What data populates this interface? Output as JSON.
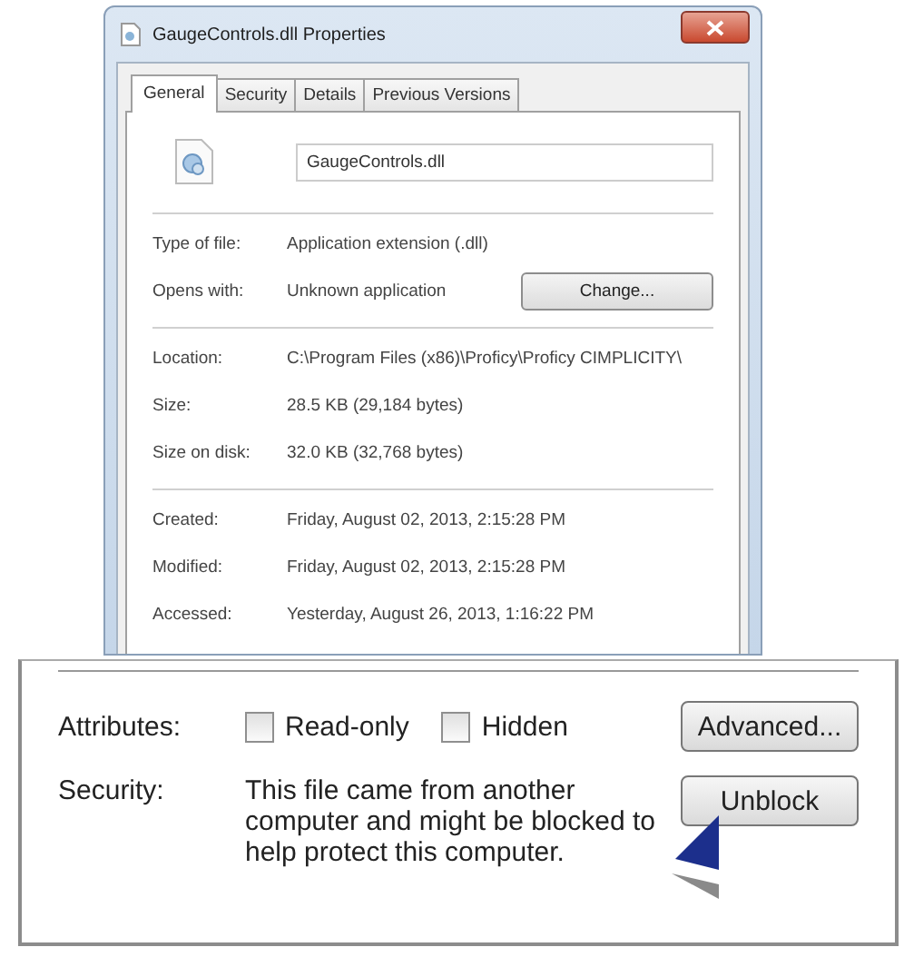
{
  "window": {
    "title": "GaugeControls.dll Properties"
  },
  "tabs": [
    {
      "label": "General",
      "selected": true
    },
    {
      "label": "Security",
      "selected": false
    },
    {
      "label": "Details",
      "selected": false
    },
    {
      "label": "Previous Versions",
      "selected": false
    }
  ],
  "file_name": "GaugeControls.dll",
  "sections": [
    [
      {
        "label": "Type of file:",
        "value": "Application extension (.dll)"
      },
      {
        "label": "Opens with:",
        "value": "Unknown application",
        "button": "Change..."
      }
    ],
    [
      {
        "label": "Location:",
        "value": "C:\\Program Files (x86)\\Proficy\\Proficy CIMPLICITY\\"
      },
      {
        "label": "Size:",
        "value": "28.5 KB (29,184 bytes)"
      },
      {
        "label": "Size on disk:",
        "value": "32.0 KB (32,768 bytes)"
      }
    ],
    [
      {
        "label": "Created:",
        "value": "Friday, August 02, 2013, 2:15:28 PM"
      },
      {
        "label": "Modified:",
        "value": "Friday, August 02, 2013, 2:15:28 PM"
      },
      {
        "label": "Accessed:",
        "value": "Yesterday, August 26, 2013, 1:16:22 PM"
      }
    ]
  ],
  "zoom_panel": {
    "attributes_label": "Attributes:",
    "attributes": [
      {
        "label": "Read-only",
        "checked": false
      },
      {
        "label": "Hidden",
        "checked": false
      }
    ],
    "advanced_button": "Advanced...",
    "security_label": "Security:",
    "security_text": "This file came from another computer and might be blocked to help protect this computer.",
    "unblock_button": "Unblock"
  }
}
